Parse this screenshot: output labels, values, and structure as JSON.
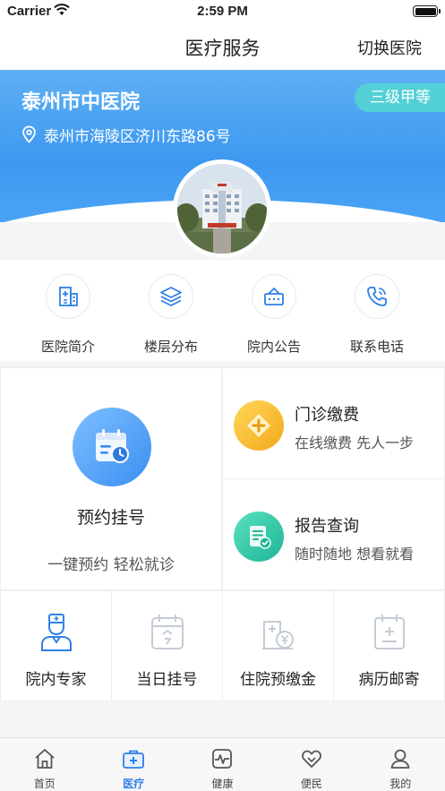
{
  "status_bar": {
    "carrier": "Carrier",
    "time": "2:59 PM"
  },
  "nav": {
    "title": "医疗服务",
    "switch_label": "切换医院"
  },
  "hospital": {
    "name": "泰州市中医院",
    "grade": "三级甲等",
    "address": "泰州市海陵区济川东路86号"
  },
  "quick_menu": [
    {
      "label": "医院简介",
      "icon": "building-icon"
    },
    {
      "label": "楼层分布",
      "icon": "layers-icon"
    },
    {
      "label": "院内公告",
      "icon": "notice-icon"
    },
    {
      "label": "联系电话",
      "icon": "phone-icon"
    }
  ],
  "services": {
    "appointment": {
      "title": "预约挂号",
      "subtitle": "一键预约 轻松就诊"
    },
    "payment": {
      "title": "门诊缴费",
      "subtitle": "在线缴费 先人一步"
    },
    "report": {
      "title": "报告查询",
      "subtitle": "随时随地 想看就看"
    },
    "small": [
      {
        "label": "院内专家",
        "icon": "doctor-icon"
      },
      {
        "label": "当日挂号",
        "icon": "calendar-today-icon"
      },
      {
        "label": "住院预缴金",
        "icon": "hospital-deposit-icon"
      },
      {
        "label": "病历邮寄",
        "icon": "medical-record-icon"
      }
    ]
  },
  "tabbar": [
    {
      "label": "首页",
      "active": false
    },
    {
      "label": "医疗",
      "active": true
    },
    {
      "label": "健康",
      "active": false
    },
    {
      "label": "便民",
      "active": false
    },
    {
      "label": "我的",
      "active": false
    }
  ],
  "colors": {
    "accent": "#2f7fe8",
    "hero": "#3d98f0",
    "grade_badge": "#53d0d6",
    "payment": "#f7b928",
    "report": "#2ec7a5"
  }
}
